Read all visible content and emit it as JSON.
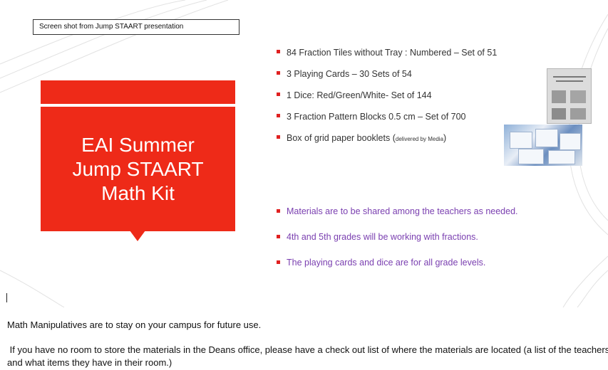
{
  "slide": {
    "caption": "Screen shot from Jump STAART presentation",
    "title": "EAI Summer\nJump STAART\nMath Kit",
    "kit_items": [
      {
        "text": "84 Fraction Tiles without Tray : Numbered – Set of 51"
      },
      {
        "text": "3 Playing Cards – 30 Sets of 54"
      },
      {
        "text": "1 Dice: Red/Green/White- Set of 144"
      },
      {
        "text": "3 Fraction Pattern Blocks 0.5 cm – Set of 700"
      },
      {
        "text": "Box of grid paper booklets (",
        "note": "delivered by Media",
        "text_end": ")"
      }
    ],
    "notes": [
      "Materials are to be shared among the teachers as needed.",
      "4th and 5th grades will be working with fractions.",
      "The playing cards and dice are for all grade levels."
    ],
    "colors": {
      "title_box": "#ee2a18",
      "bullet": "#e02020",
      "note_text": "#7a3fb0"
    }
  },
  "body": {
    "paragraph1": "Math Manipulatives are to stay on your campus for future use.",
    "paragraph2": " If you have no room to store the materials in the Deans office, please have a check out list of where the materials are located (a list of the teachers and what items they have in their room.)"
  }
}
